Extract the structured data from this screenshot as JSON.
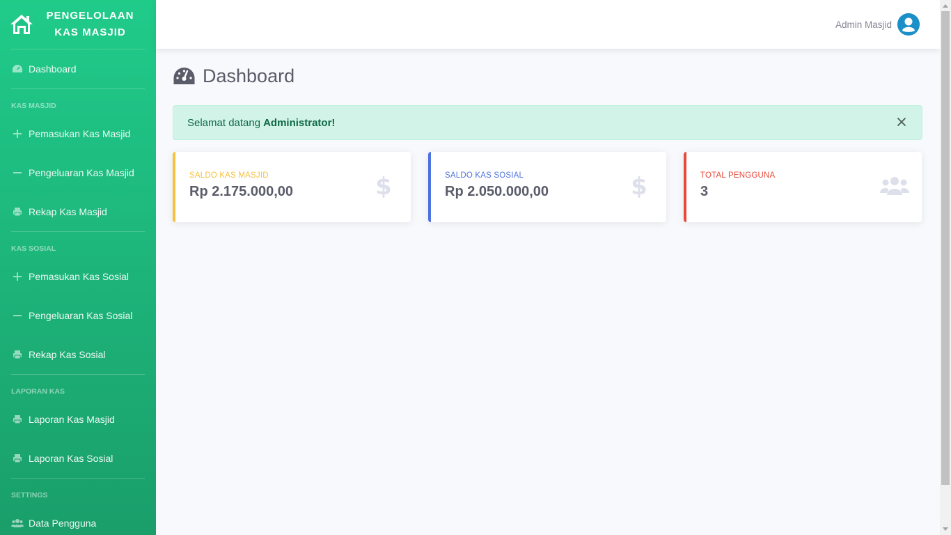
{
  "brand": {
    "line1": "PENGELOLAAN",
    "line2": "KAS MASJID",
    "icon": "home-icon"
  },
  "sidebar": {
    "dashboard": {
      "label": "Dashboard",
      "icon": "tachometer-icon"
    },
    "sections": [
      {
        "heading": "KAS MASJID",
        "items": [
          {
            "label": "Pemasukan Kas Masjid",
            "icon": "plus-icon"
          },
          {
            "label": "Pengeluaran Kas Masjid",
            "icon": "minus-icon"
          },
          {
            "label": "Rekap Kas Masjid",
            "icon": "print-icon"
          }
        ]
      },
      {
        "heading": "KAS SOSIAL",
        "items": [
          {
            "label": "Pemasukan Kas Sosial",
            "icon": "plus-icon"
          },
          {
            "label": "Pengeluaran Kas Sosial",
            "icon": "minus-icon"
          },
          {
            "label": "Rekap Kas Sosial",
            "icon": "print-icon"
          }
        ]
      },
      {
        "heading": "LAPORAN KAS",
        "items": [
          {
            "label": "Laporan Kas Masjid",
            "icon": "print-icon"
          },
          {
            "label": "Laporan Kas Sosial",
            "icon": "print-icon"
          }
        ]
      },
      {
        "heading": "SETTINGS",
        "items": [
          {
            "label": "Data Pengguna",
            "icon": "users-icon"
          }
        ]
      }
    ]
  },
  "topbar": {
    "user_name": "Admin Masjid",
    "avatar_icon": "user-circle-icon"
  },
  "page": {
    "title": "Dashboard",
    "alert": {
      "prefix": "Selamat datang",
      "name": "Administrator!"
    }
  },
  "cards": [
    {
      "label": "SALDO KAS MASJID",
      "value": "Rp 2.175.000,00",
      "icon": "dollar-icon",
      "accent": "#f6c23e"
    },
    {
      "label": "SALDO KAS SOSIAL",
      "value": "Rp 2.050.000,00",
      "icon": "dollar-icon",
      "accent": "#4e73df"
    },
    {
      "label": "TOTAL PENGGUNA",
      "value": "3",
      "icon": "users-icon",
      "accent": "#e74a3b"
    }
  ],
  "colors": {
    "sidebar_top": "#20cb8a",
    "sidebar_bottom": "#1a9e6a",
    "alert_bg": "#d2f4e8",
    "avatar": "#1a8fc8"
  }
}
